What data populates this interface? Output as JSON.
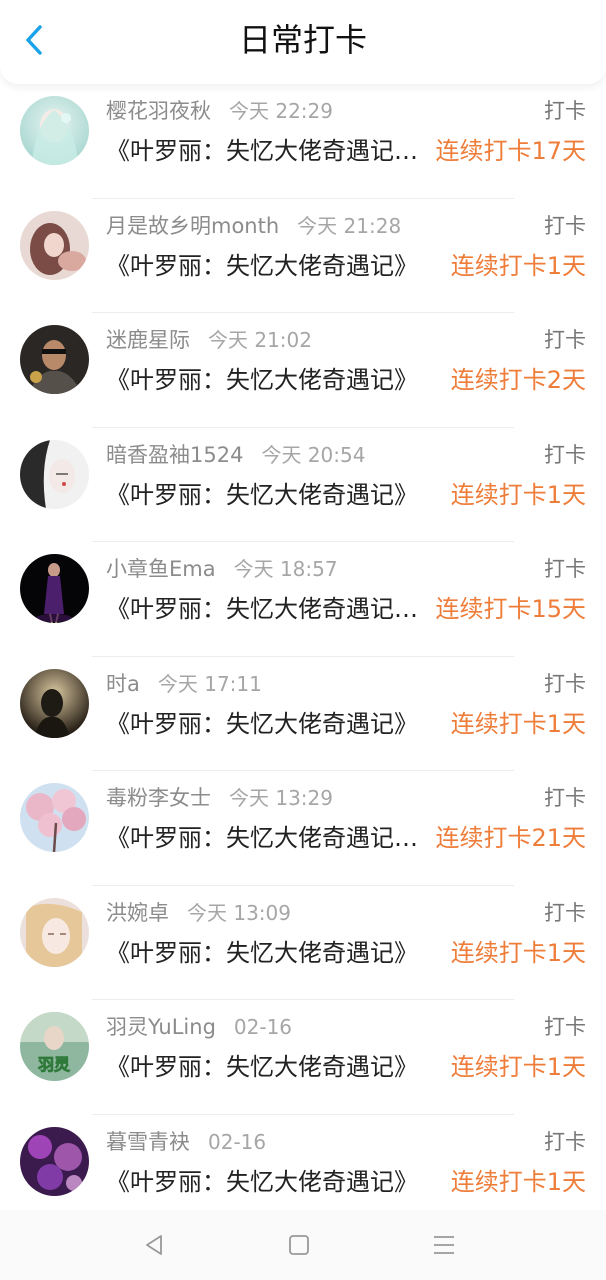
{
  "header": {
    "title": "日常打卡"
  },
  "action_label": "打卡",
  "accent_color": "#ef7d3a",
  "entries": [
    {
      "name": "樱花羽夜秋",
      "time": "今天 22:29",
      "book": "《叶罗丽：失忆大佬奇遇记…",
      "streak": "连续打卡17天"
    },
    {
      "name": "月是故乡明month",
      "time": "今天 21:28",
      "book": "《叶罗丽：失忆大佬奇遇记》",
      "streak": "连续打卡1天"
    },
    {
      "name": "迷鹿星际",
      "time": "今天 21:02",
      "book": "《叶罗丽：失忆大佬奇遇记》",
      "streak": "连续打卡2天"
    },
    {
      "name": "暗香盈袖1524",
      "time": "今天 20:54",
      "book": "《叶罗丽：失忆大佬奇遇记》",
      "streak": "连续打卡1天"
    },
    {
      "name": "小章鱼Ema",
      "time": "今天 18:57",
      "book": "《叶罗丽：失忆大佬奇遇记…",
      "streak": "连续打卡15天"
    },
    {
      "name": "时a",
      "time": "今天 17:11",
      "book": "《叶罗丽：失忆大佬奇遇记》",
      "streak": "连续打卡1天"
    },
    {
      "name": "毒粉李女士",
      "time": "今天 13:29",
      "book": "《叶罗丽：失忆大佬奇遇记…",
      "streak": "连续打卡21天"
    },
    {
      "name": "洪婉卓",
      "time": "今天 13:09",
      "book": "《叶罗丽：失忆大佬奇遇记》",
      "streak": "连续打卡1天"
    },
    {
      "name": "羽灵YuLing",
      "time": "02-16",
      "book": "《叶罗丽：失忆大佬奇遇记》",
      "streak": "连续打卡1天",
      "avatar_text": "羽灵"
    },
    {
      "name": "暮雪青袂",
      "time": "02-16",
      "book": "《叶罗丽：失忆大佬奇遇记》",
      "streak": "连续打卡1天"
    }
  ]
}
